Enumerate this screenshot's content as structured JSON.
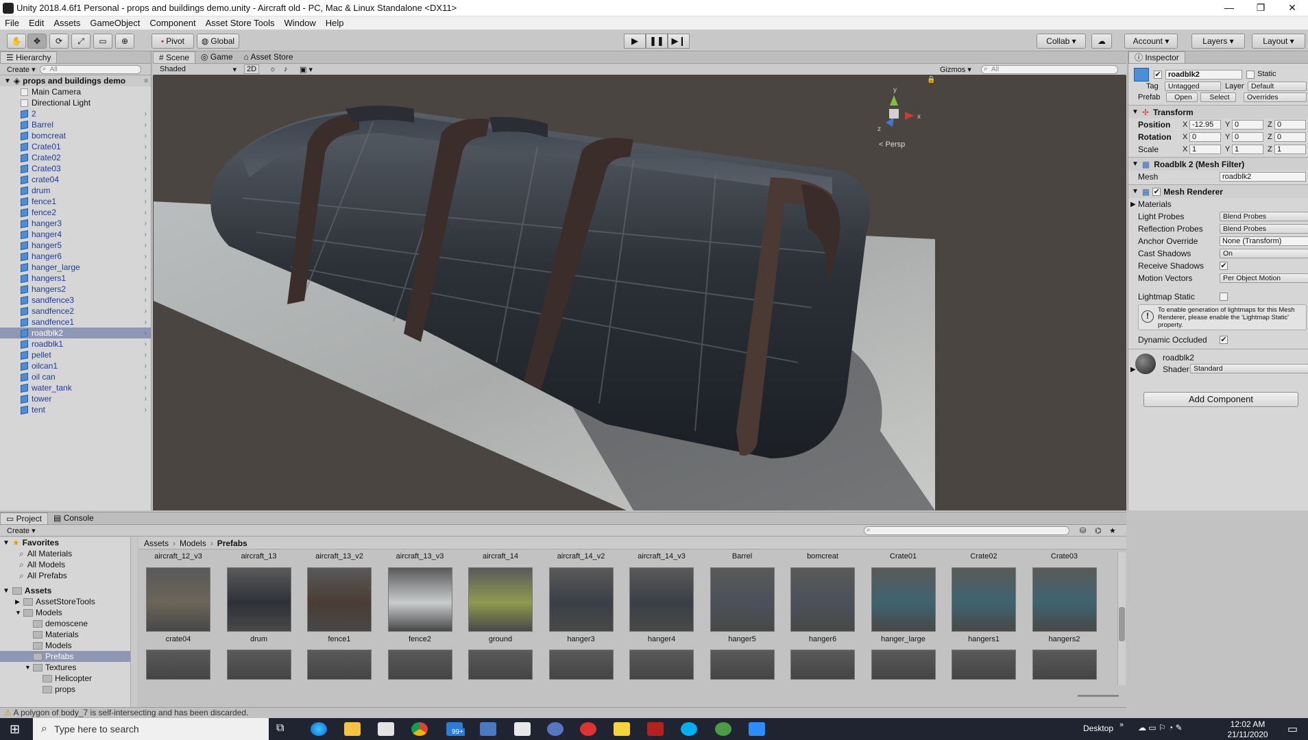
{
  "window": {
    "title": "Unity 2018.4.6f1 Personal - props and buildings demo.unity - Aircraft old - PC, Mac & Linux Standalone <DX11>"
  },
  "menu": [
    "File",
    "Edit",
    "Assets",
    "GameObject",
    "Component",
    "Asset Store Tools",
    "Window",
    "Help"
  ],
  "toolbar": {
    "pivot": "Pivot",
    "global": "Global",
    "collab": "Collab",
    "account": "Account",
    "layers": "Layers",
    "layout": "Layout"
  },
  "hierarchy": {
    "tab": "Hierarchy",
    "create": "Create",
    "search": "All",
    "scene": "props and buildings demo",
    "items": [
      {
        "label": "Main Camera",
        "prefab": false
      },
      {
        "label": "Directional Light",
        "prefab": false
      },
      {
        "label": "2",
        "prefab": true
      },
      {
        "label": "Barrel",
        "prefab": true
      },
      {
        "label": "bomcreat",
        "prefab": true
      },
      {
        "label": "Crate01",
        "prefab": true
      },
      {
        "label": "Crate02",
        "prefab": true
      },
      {
        "label": "Crate03",
        "prefab": true
      },
      {
        "label": "crate04",
        "prefab": true
      },
      {
        "label": "drum",
        "prefab": true
      },
      {
        "label": "fence1",
        "prefab": true
      },
      {
        "label": "fence2",
        "prefab": true
      },
      {
        "label": "hanger3",
        "prefab": true
      },
      {
        "label": "hanger4",
        "prefab": true
      },
      {
        "label": "hanger5",
        "prefab": true
      },
      {
        "label": "hanger6",
        "prefab": true
      },
      {
        "label": "hanger_large",
        "prefab": true
      },
      {
        "label": "hangers1",
        "prefab": true
      },
      {
        "label": "hangers2",
        "prefab": true
      },
      {
        "label": "sandfence3",
        "prefab": true
      },
      {
        "label": "sandfence2",
        "prefab": true
      },
      {
        "label": "sandfence1",
        "prefab": true
      },
      {
        "label": "roadblk2",
        "prefab": true,
        "selected": true
      },
      {
        "label": "roadblk1",
        "prefab": true
      },
      {
        "label": "pellet",
        "prefab": true
      },
      {
        "label": "oilcan1",
        "prefab": true
      },
      {
        "label": "oil can",
        "prefab": true
      },
      {
        "label": "water_tank",
        "prefab": true
      },
      {
        "label": "tower",
        "prefab": true
      },
      {
        "label": "tent",
        "prefab": true
      }
    ]
  },
  "scene": {
    "tabs": [
      "Scene",
      "Game",
      "Asset Store"
    ],
    "shading": "Shaded",
    "mode2d": "2D",
    "gizmos": "Gizmos",
    "search": "All",
    "persp": "< Persp"
  },
  "inspector": {
    "tab": "Inspector",
    "name": "roadblk2",
    "static": "Static",
    "tag_label": "Tag",
    "tag": "Untagged",
    "layer_label": "Layer",
    "layer": "Default",
    "prefab_label": "Prefab",
    "open": "Open",
    "select": "Select",
    "overrides": "Overrides",
    "transform": {
      "title": "Transform",
      "position": "Position",
      "rotation": "Rotation",
      "scale": "Scale",
      "pos": [
        "-12.95",
        "0",
        "0"
      ],
      "rot": [
        "0",
        "0",
        "0"
      ],
      "scl": [
        "1",
        "1",
        "1"
      ]
    },
    "meshfilter": {
      "title": "Roadblk 2 (Mesh Filter)",
      "mesh_label": "Mesh",
      "mesh": "roadblk2"
    },
    "renderer": {
      "title": "Mesh Renderer",
      "materials": "Materials",
      "light_probes_label": "Light Probes",
      "light_probes": "Blend Probes",
      "reflection_label": "Reflection Probes",
      "reflection": "Blend Probes",
      "anchor_label": "Anchor Override",
      "anchor": "None (Transform)",
      "cast_label": "Cast Shadows",
      "cast": "On",
      "receive_label": "Receive Shadows",
      "motion_label": "Motion Vectors",
      "motion": "Per Object Motion",
      "lightmap_label": "Lightmap Static",
      "info": "To enable generation of lightmaps for this Mesh Renderer, please enable the 'Lightmap Static' property.",
      "occluded_label": "Dynamic Occluded"
    },
    "material": {
      "name": "roadblk2",
      "shader_label": "Shader",
      "shader": "Standard"
    },
    "add_component": "Add Component"
  },
  "project": {
    "tabs": [
      "Project",
      "Console"
    ],
    "create": "Create",
    "favorites": "Favorites",
    "fav_items": [
      "All Materials",
      "All Models",
      "All Prefabs"
    ],
    "assets": "Assets",
    "tree": [
      {
        "label": "AssetStoreTools",
        "indent": 1
      },
      {
        "label": "Models",
        "indent": 1
      },
      {
        "label": "demoscene",
        "indent": 2
      },
      {
        "label": "Materials",
        "indent": 2
      },
      {
        "label": "Models",
        "indent": 2
      },
      {
        "label": "Prefabs",
        "indent": 2,
        "selected": true
      },
      {
        "label": "Textures",
        "indent": 2
      },
      {
        "label": "Helicopter",
        "indent": 3
      },
      {
        "label": "props",
        "indent": 3
      }
    ],
    "breadcrumb": [
      "Assets",
      "Models",
      "Prefabs"
    ],
    "top_labels": [
      "aircraft_12_v3",
      "aircraft_13",
      "aircraft_13_v2",
      "aircraft_13_v3",
      "aircraft_14",
      "aircraft_14_v2",
      "aircraft_14_v3",
      "Barrel",
      "bomcreat",
      "Crate01",
      "Crate02",
      "Crate03"
    ],
    "row_labels": [
      "crate04",
      "drum",
      "fence1",
      "fence2",
      "ground",
      "hanger3",
      "hanger4",
      "hanger5",
      "hanger6",
      "hanger_large",
      "hangers1",
      "hangers2"
    ],
    "thumb_colors": [
      "#6b6458",
      "#2e3137",
      "#4a3c34",
      "#c9ccce",
      "#8f9a4e",
      "#3a3f48",
      "#3a3f48",
      "#4a505a",
      "#4a505a",
      "#3e6470",
      "#3e6470",
      "#3e6470"
    ]
  },
  "console": {
    "message": "A polygon of body_7 is self-intersecting and has been discarded."
  },
  "taskbar": {
    "search": "Type here to search",
    "desktop": "Desktop",
    "time": "12:02 AM",
    "date": "21/11/2020",
    "badge": "99+"
  }
}
